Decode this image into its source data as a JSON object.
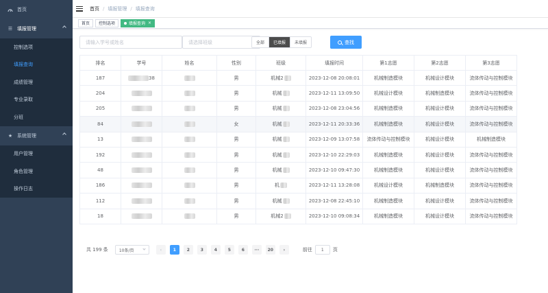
{
  "sidebar": {
    "home": "首页",
    "groups": [
      {
        "label": "填报管理",
        "items": [
          "控制选项",
          "填报查询",
          "成绩管理",
          "专业录取",
          "分班"
        ],
        "active": 1
      },
      {
        "label": "系统管理",
        "items": [
          "用户管理",
          "角色管理",
          "操作日志"
        ]
      }
    ]
  },
  "navbar": {
    "breadcrumb": [
      "首页",
      "填报管理",
      "填报查询"
    ]
  },
  "tags": [
    "首页",
    "控制选项",
    "填报查询"
  ],
  "filter": {
    "keyword_placeholder": "请输入学号或姓名",
    "class_placeholder": "请选择班级",
    "segments": [
      "全部",
      "已填报",
      "未填报"
    ],
    "active_segment": 1,
    "search_label": "查找"
  },
  "table": {
    "headers": [
      "排名",
      "学号",
      "姓名",
      "性别",
      "班级",
      "填报时间",
      "第1志愿",
      "第2志愿",
      "第3志愿"
    ],
    "rows": [
      [
        "187",
        "38",
        "",
        "男",
        "机械2",
        "2023-12-08 20:08:01",
        "机械制造模块",
        "机械设计模块",
        "流体传动与控制模块"
      ],
      [
        "204",
        "",
        "",
        "男",
        "机械",
        "2023-12-11 13:09:50",
        "机械设计模块",
        "机械制造模块",
        "流体传动与控制模块"
      ],
      [
        "205",
        "",
        "",
        "男",
        "机械",
        "2023-12-08 23:04:56",
        "机械制造模块",
        "机械设计模块",
        "流体传动与控制模块"
      ],
      [
        "84",
        "",
        "",
        "女",
        "机械",
        "2023-12-11 20:33:36",
        "机械制造模块",
        "机械设计模块",
        "流体传动与控制模块"
      ],
      [
        "13",
        "",
        "",
        "男",
        "机械",
        "2023-12-09 13:07:58",
        "流体传动与控制模块",
        "机械设计模块",
        "机械制造模块"
      ],
      [
        "192",
        "",
        "",
        "男",
        "机械",
        "2023-12-10 22:29:03",
        "机械制造模块",
        "机械设计模块",
        "流体传动与控制模块"
      ],
      [
        "48",
        "",
        "",
        "男",
        "机械",
        "2023-12-10 09:47:30",
        "机械制造模块",
        "机械设计模块",
        "流体传动与控制模块"
      ],
      [
        "186",
        "",
        "",
        "男",
        "机",
        "2023-12-11 13:28:08",
        "机械设计模块",
        "机械制造模块",
        "流体传动与控制模块"
      ],
      [
        "112",
        "",
        "",
        "男",
        "机械",
        "2023-12-08 22:45:10",
        "机械制造模块",
        "机械设计模块",
        "流体传动与控制模块"
      ],
      [
        "18",
        "",
        "",
        "男",
        "机械2",
        "2023-12-10 09:08:34",
        "机械制造模块",
        "机械设计模块",
        "流体传动与控制模块"
      ]
    ],
    "highlight_row": 3
  },
  "pagination": {
    "total_text": "共 199 条",
    "page_size": "10条/页",
    "prev": "‹",
    "pages": [
      "1",
      "2",
      "3",
      "4",
      "5",
      "6",
      "···",
      "20"
    ],
    "active_page": 0,
    "next": "›",
    "goto_label": "前往",
    "goto_value": "1",
    "goto_suffix": "页"
  }
}
